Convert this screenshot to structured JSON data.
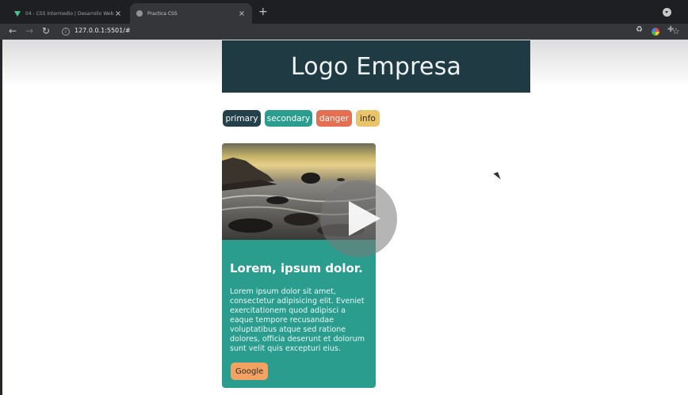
{
  "browser": {
    "tabs": [
      {
        "title": "04 - CSS Intermedio | Desarrollo Web",
        "active": false
      },
      {
        "title": "Practica CSS",
        "active": true
      }
    ],
    "new_tab_label": "+",
    "close_label": "×",
    "url": "127.0.0.1:5501/#"
  },
  "page": {
    "header_title": "Logo Empresa",
    "buttons": [
      {
        "label": "primary",
        "color": "#23404b"
      },
      {
        "label": "secondary",
        "color": "#2a9d8f"
      },
      {
        "label": "danger",
        "color": "#e76f51"
      },
      {
        "label": "info",
        "color": "#e9c46a"
      }
    ],
    "card": {
      "title": "Lorem, ipsum dolor.",
      "text": "Lorem ipsum dolor sit amet, consectetur adipisicing elit. Eveniet exercitationem quod adipisci a eaque tempore recusandae voluptatibus atque sed ratione dolores, officia deserunt et dolorum sunt velit quis excepturi eius.",
      "button_label": "Google",
      "color": "#2a9d8f"
    }
  }
}
